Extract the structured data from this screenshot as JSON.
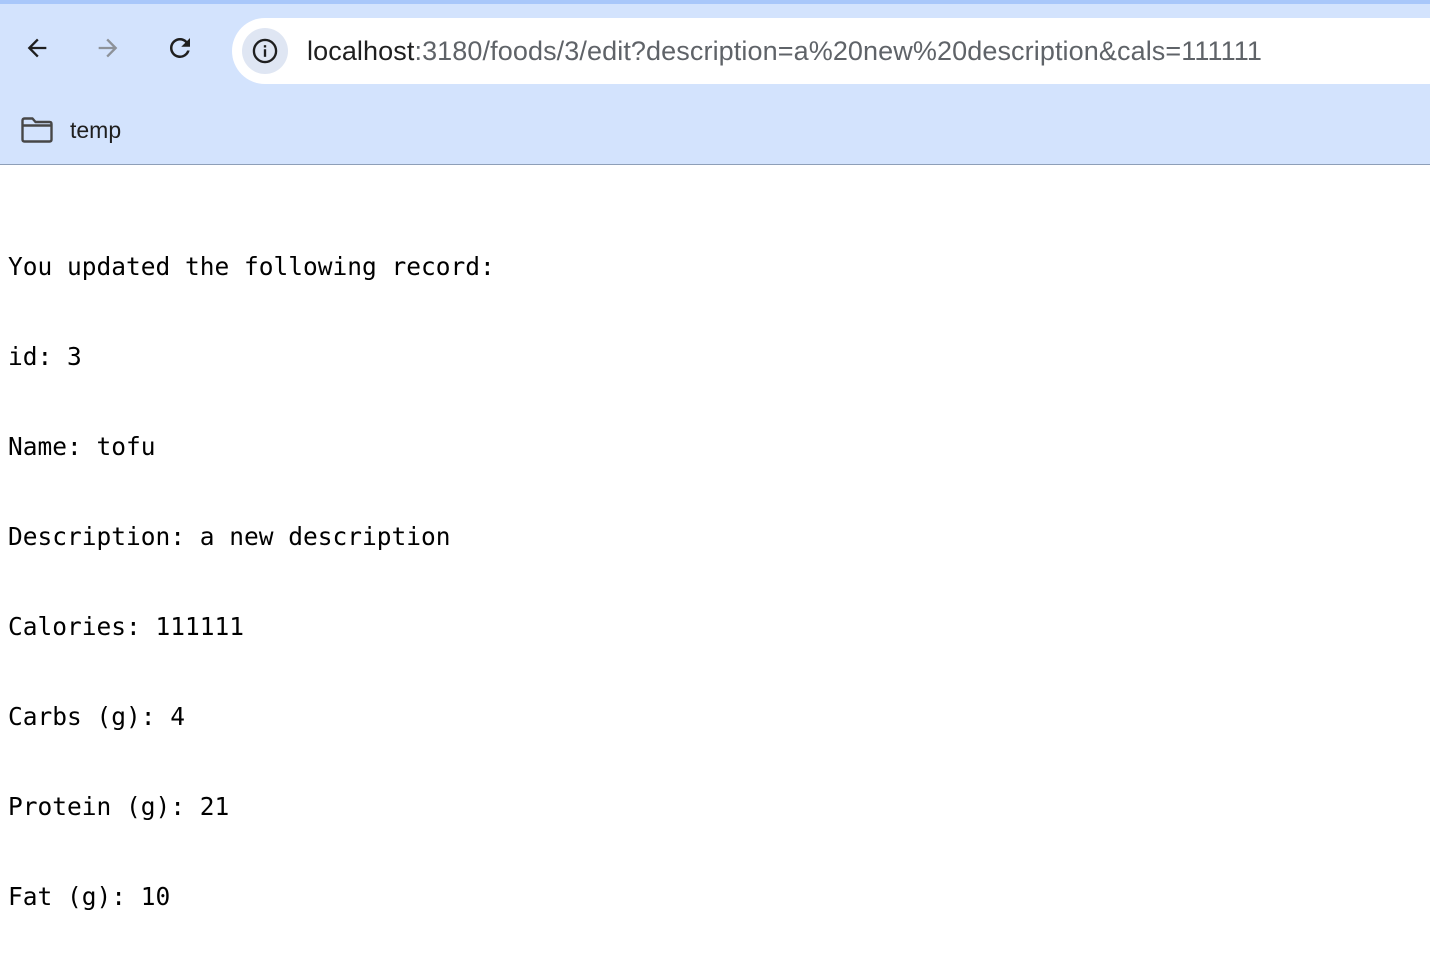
{
  "browser": {
    "url_host": "localhost",
    "url_rest": ":3180/foods/3/edit?description=a%20new%20description&cals=111111",
    "bookmarks": [
      {
        "label": "temp",
        "icon": "folder-icon"
      }
    ],
    "accent_color": "#d3e3fd"
  },
  "page": {
    "lines": [
      "You updated the following record:",
      "id: 3",
      "Name: tofu",
      "Description: a new description",
      "Calories: 111111",
      "Carbs (g): 4",
      "Protein (g): 21",
      "Fat (g): 10"
    ]
  }
}
